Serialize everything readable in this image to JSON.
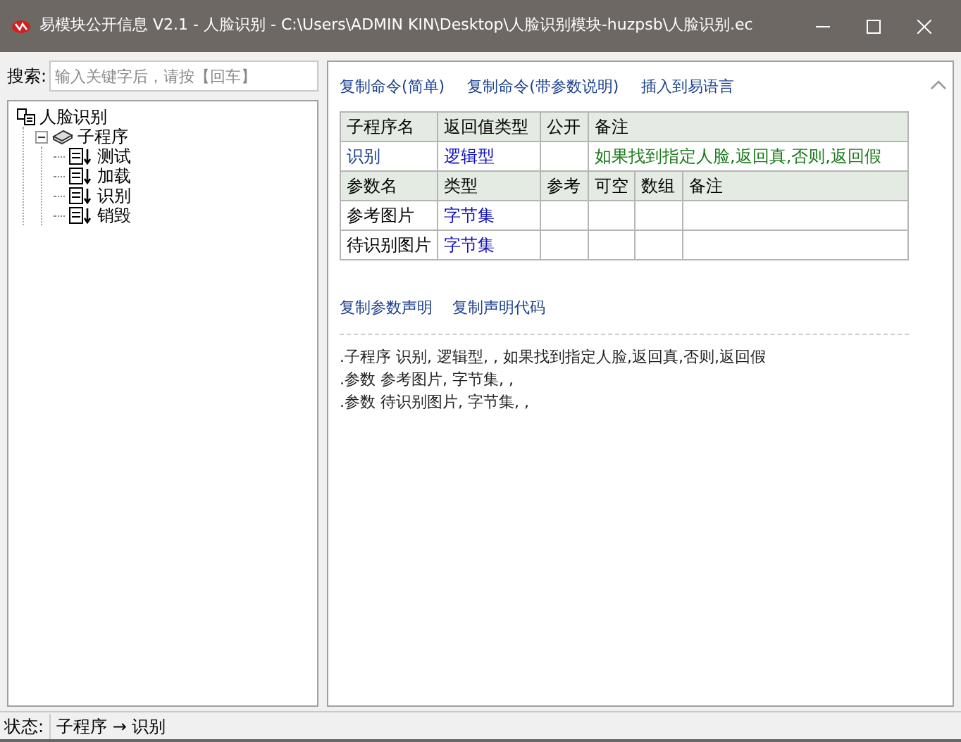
{
  "window": {
    "title": "易模块公开信息 V2.1 - 人脸识别 - C:\\Users\\ADMIN KIN\\Desktop\\人脸识别模块-huzpsb\\人脸识别.ec"
  },
  "search": {
    "label": "搜索:",
    "placeholder": "输入关键字后，请按【回车】"
  },
  "tree": [
    {
      "label": "人脸识别",
      "kind": "module",
      "children": [
        {
          "label": "子程序",
          "kind": "group",
          "expanded": true,
          "children": [
            {
              "label": "测试",
              "kind": "sub"
            },
            {
              "label": "加载",
              "kind": "sub"
            },
            {
              "label": "识别",
              "kind": "sub"
            },
            {
              "label": "销毁",
              "kind": "sub"
            }
          ]
        }
      ]
    }
  ],
  "links": [
    "复制命令(简单)",
    "复制命令(带参数说明)",
    "插入到易语言"
  ],
  "table": {
    "sub_columns": [
      "子程序名",
      "返回值类型",
      "公开",
      "备注"
    ],
    "sub_row": {
      "name": "识别",
      "return_type": "逻辑型",
      "note": "如果找到指定人脸,返回真,否则,返回假"
    },
    "param_columns": [
      "参数名",
      "类型",
      "参考",
      "可空",
      "数组",
      "备注"
    ],
    "params": [
      {
        "name": "参考图片",
        "type": "字节集"
      },
      {
        "name": "待识别图片",
        "type": "字节集"
      }
    ]
  },
  "links2": [
    "复制参数声明",
    "复制声明代码"
  ],
  "code_lines": [
    ".子程序 识别, 逻辑型, , 如果找到指定人脸,返回真,否则,返回假",
    ".参数 参考图片, 字节集, ,",
    ".参数 待识别图片, 字节集, ,"
  ],
  "status": {
    "label": "状态:",
    "path": "子程序 → 识别"
  }
}
